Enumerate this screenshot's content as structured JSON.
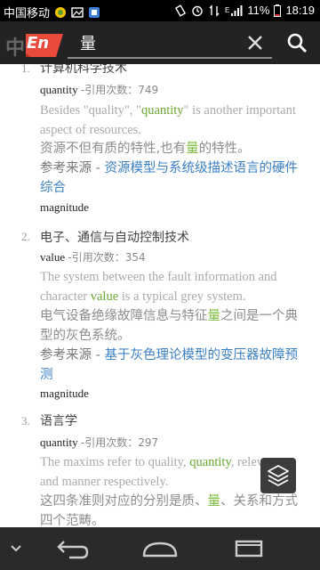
{
  "status": {
    "carrier": "中国移动",
    "battery": "11%",
    "time": "18:19",
    "network": "E"
  },
  "toolbar": {
    "brand_ghost": "中",
    "lang_badge": "En",
    "search_value": "量",
    "icons": [
      "close-icon",
      "search-icon"
    ]
  },
  "entries": [
    {
      "num": "1.",
      "field": "计算机科学技术",
      "term": "quantity",
      "count_label": "-引用次数：749",
      "en_pre": "Besides \"quality\", \"",
      "en_hl": "quantity",
      "en_post": "\" is another important aspect of resources.",
      "zh_pre": "资源不但有质的特性,也有",
      "zh_hl": "量",
      "zh_post": "的特性。",
      "src_label": "参考来源 - ",
      "src_title": "资源模型与系统级描述语言的硬件综合",
      "extra": "magnitude"
    },
    {
      "num": "2.",
      "field": "电子、通信与自动控制技术",
      "term": "value",
      "count_label": "-引用次数：354",
      "en_pre": "The system between the fault information and character ",
      "en_hl": "value",
      "en_post": " is a typical grey system.",
      "zh_pre": "电气设备绝缘故障信息与特征",
      "zh_hl": "量",
      "zh_post": "之间是一个典型的灰色系统。",
      "src_label": "参考来源 - ",
      "src_title": "基于灰色理论模型的变压器故障预测",
      "extra": "magnitude"
    },
    {
      "num": "3.",
      "field": "语言学",
      "term": "quantity",
      "count_label": "-引用次数：297",
      "en_pre": "The maxims refer to quality, ",
      "en_hl": "quantity",
      "en_post": ", relevance and manner respectively.",
      "zh_pre": "这四条准则对应的分别是质、",
      "zh_hl": "量",
      "zh_post": "、关系和方式四个范畴。"
    }
  ],
  "colors": {
    "toolbar_bg": "#232323",
    "accent_red": "#e84a3c",
    "highlight_green": "#6aa832",
    "link_blue": "#3a7fc4",
    "navbar_bg": "#2a2a2a"
  }
}
